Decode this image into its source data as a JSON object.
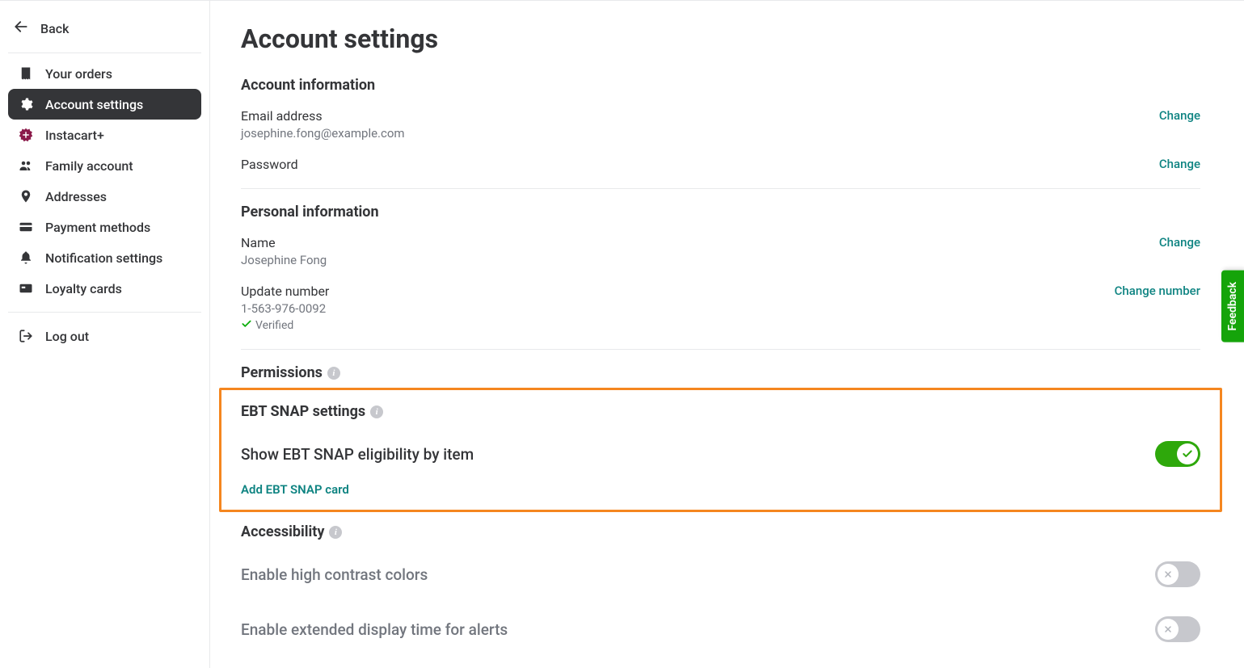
{
  "sidebar": {
    "back_label": "Back",
    "items": [
      {
        "label": "Your orders",
        "name": "sidebar-item-orders",
        "icon": "receipt"
      },
      {
        "label": "Account settings",
        "name": "sidebar-item-account",
        "icon": "gear",
        "active": true
      },
      {
        "label": "Instacart+",
        "name": "sidebar-item-instacartplus",
        "icon": "plus-badge"
      },
      {
        "label": "Family account",
        "name": "sidebar-item-family",
        "icon": "people"
      },
      {
        "label": "Addresses",
        "name": "sidebar-item-addresses",
        "icon": "pin"
      },
      {
        "label": "Payment methods",
        "name": "sidebar-item-payment",
        "icon": "card"
      },
      {
        "label": "Notification settings",
        "name": "sidebar-item-notifications",
        "icon": "bell"
      },
      {
        "label": "Loyalty cards",
        "name": "sidebar-item-loyalty",
        "icon": "barcode-card"
      }
    ],
    "logout_label": "Log out"
  },
  "page": {
    "title": "Account settings"
  },
  "sections": {
    "account_info": {
      "heading": "Account information",
      "email_label": "Email address",
      "email_value": "josephine.fong@example.com",
      "password_label": "Password",
      "change_label": "Change"
    },
    "personal_info": {
      "heading": "Personal information",
      "name_label": "Name",
      "name_value": "Josephine Fong",
      "number_label": "Update number",
      "number_value": "1-563-976-0092",
      "verified_label": "Verified",
      "change_label": "Change",
      "change_number_label": "Change number"
    },
    "permissions": {
      "heading": "Permissions"
    },
    "ebt": {
      "heading": "EBT SNAP settings",
      "toggle_label": "Show EBT SNAP eligibility by item",
      "toggle_on": true,
      "add_card_label": "Add EBT SNAP card"
    },
    "accessibility": {
      "heading": "Accessibility",
      "high_contrast_label": "Enable high contrast colors",
      "high_contrast_on": false,
      "extended_alerts_label": "Enable extended display time for alerts",
      "extended_alerts_on": false
    }
  },
  "feedback_label": "Feedback"
}
